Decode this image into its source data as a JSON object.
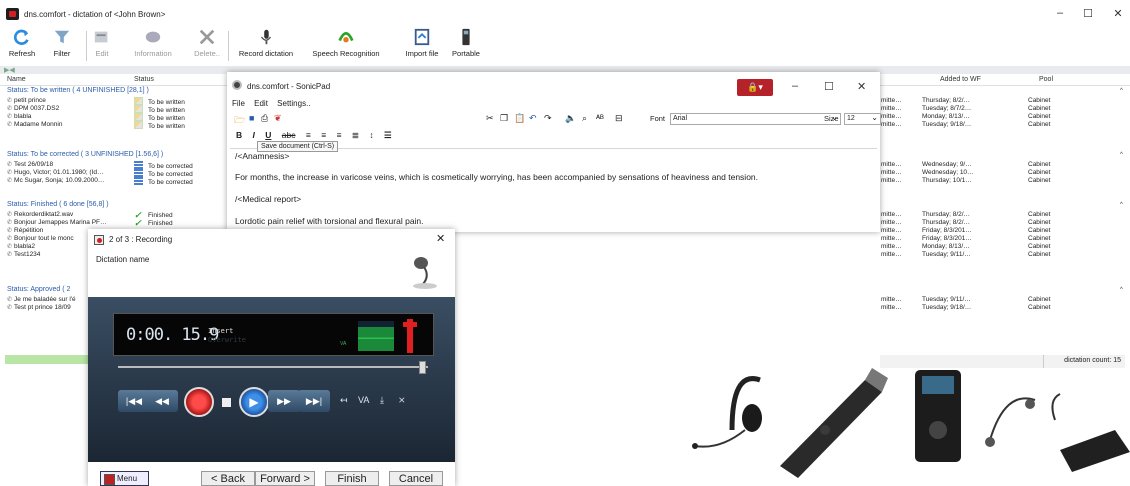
{
  "window": {
    "title": "dns.comfort - dictation of <John Brown>",
    "controls": [
      "–",
      "☐",
      "✕"
    ]
  },
  "toolbar": {
    "refresh": "Refresh",
    "filter": "Filter",
    "edit": "Edit",
    "information": "Information",
    "delete": "Delete..",
    "record_dictation": "Record dictation",
    "speech_recognition": "Speech Recognition",
    "import_file": "Import file",
    "portable": "Portable"
  },
  "columns": {
    "name": "Name",
    "status": "Status",
    "added": "Added to WF",
    "pool": "Pool"
  },
  "groups": [
    {
      "header": "Status: To be written ( 4 UNFINISHED [28,1] )",
      "rows": [
        {
          "name": "petit prince",
          "status": "To be written",
          "icon": "to-be-written-icon",
          "col3": "mitte…",
          "date": "Thursday; 8/2/…",
          "pool": "Cabinet"
        },
        {
          "name": "DPM 0037.DS2",
          "status": "To be written",
          "icon": "to-be-written-icon",
          "col3": "mitte…",
          "date": "Tuesday; 8/7/2…",
          "pool": "Cabinet"
        },
        {
          "name": "blabla",
          "status": "To be written",
          "icon": "to-be-written-icon",
          "col3": "mitte…",
          "date": "Monday; 8/13/…",
          "pool": "Cabinet"
        },
        {
          "name": "Madame Monnin",
          "status": "To be written",
          "icon": "to-be-written-icon",
          "col3": "mitte…",
          "date": "Tuesday; 9/18/…",
          "pool": "Cabinet"
        }
      ]
    },
    {
      "header": "Status: To be corrected ( 3 UNFINISHED [1.56,6] )",
      "rows": [
        {
          "name": "Test 26/09/18",
          "status": "To be corrected",
          "icon": "to-be-corrected-icon",
          "col3": "mitte…",
          "date": "Wednesday; 9/…",
          "pool": "Cabinet"
        },
        {
          "name": "Hugo, Victor; 01.01.1980; (Id…",
          "status": "To be corrected",
          "icon": "to-be-corrected-icon",
          "col3": "mitte…",
          "date": "Wednesday; 10…",
          "pool": "Cabinet"
        },
        {
          "name": "Mc Sugar, Sonja; 10.09.2000…",
          "status": "To be corrected",
          "icon": "to-be-corrected-icon",
          "col3": "mitte…",
          "date": "Thursday; 10/1…",
          "pool": "Cabinet"
        }
      ]
    },
    {
      "header": "Status: Finished ( 6 done [56,8] )",
      "rows": [
        {
          "name": "Rekorderdiktat2.wav",
          "status": "Finished",
          "icon": "finished-check-icon",
          "col3": "mitte…",
          "date": "Thursday; 8/2/…",
          "pool": "Cabinet"
        },
        {
          "name": "Bonjour Jemappes Marina PF…",
          "status": "Finished",
          "icon": "finished-check-icon",
          "col3": "mitte…",
          "date": "Thursday; 8/2/…",
          "pool": "Cabinet"
        },
        {
          "name": "Répétition",
          "status": "",
          "icon": "",
          "col3": "mitte…",
          "date": "Friday; 8/3/201…",
          "pool": "Cabinet"
        },
        {
          "name": "Bonjour tout le monc",
          "status": "",
          "icon": "",
          "col3": "mitte…",
          "date": "Friday; 8/3/201…",
          "pool": "Cabinet"
        },
        {
          "name": "blabla2",
          "status": "",
          "icon": "",
          "col3": "mitte…",
          "date": "Monday; 8/13/…",
          "pool": "Cabinet"
        },
        {
          "name": "Test1234",
          "status": "",
          "icon": "",
          "col3": "mitte…",
          "date": "Tuesday; 9/11/…",
          "pool": "Cabinet"
        }
      ]
    },
    {
      "header": "Status: Approved ( 2",
      "rows": [
        {
          "name": "Je me baladée sur l'é",
          "status": "",
          "icon": "",
          "col3": "mitte…",
          "date": "Tuesday; 9/11/…",
          "pool": "Cabinet"
        },
        {
          "name": "Test pt prince 18/09",
          "status": "",
          "icon": "",
          "col3": "mitte…",
          "date": "Tuesday; 9/18/…",
          "pool": "Cabinet"
        }
      ]
    }
  ],
  "status_bar": {
    "dictation_count": "dictation count: 15"
  },
  "sonicpad": {
    "title": "dns.comfort - SonicPad",
    "menu": [
      "File",
      "Edit",
      "Settings.."
    ],
    "font_label": "Font",
    "font_value": "Arial",
    "size_label": "Size",
    "size_value": "12",
    "tooltip": "Save document (Ctrl-S)",
    "lines": [
      "/<Anamnesis>",
      "For months, the increase in varicose veins, which is cosmetically worrying, has been accompanied by sensations of heaviness and tension.",
      "/<Medical report>",
      "Lordotic pain relief with torsional and flexural pain."
    ]
  },
  "recording": {
    "title": "2 of 3 : Recording",
    "dictation_name_label": "Dictation name",
    "time": "0:00. 15.9",
    "mode_insert": "Insert",
    "mode_overwrite": "Overwrite",
    "va_label": "VA",
    "transport_va": "VA",
    "buttons": {
      "menu": "Menu",
      "back": "< Back",
      "forward": "Forward >",
      "finish": "Finish",
      "cancel": "Cancel"
    }
  },
  "colors": {
    "group_header": "#2a5caa",
    "progress": "#b9e6a6",
    "lock_red": "#b5222a",
    "panel_dark": "#2a3a4a"
  }
}
